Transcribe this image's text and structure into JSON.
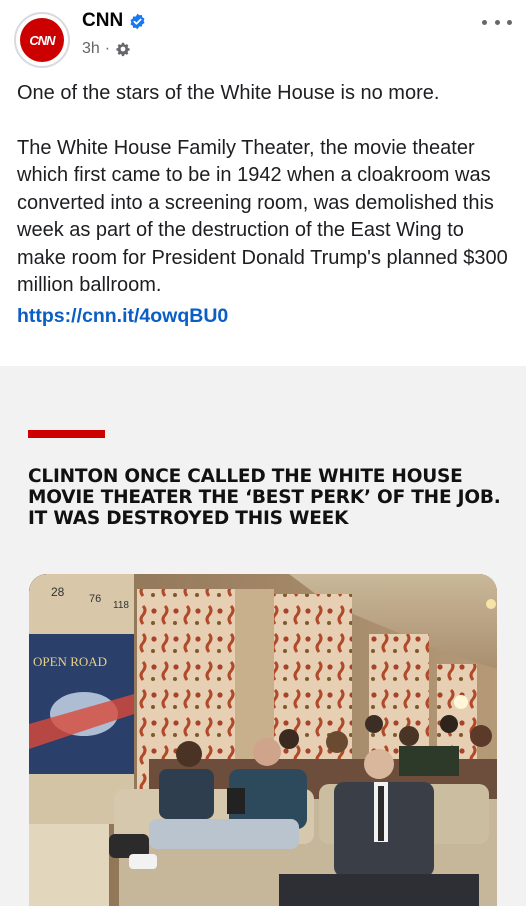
{
  "header": {
    "page_name": "CNN",
    "avatar_text": "CNN",
    "timestamp": "3h",
    "separator": "·"
  },
  "post": {
    "line1": "One of the stars of the White House is no more.",
    "body": "The White House Family Theater, the movie theater which first came to be in 1942 when a cloakroom was converted into a screening room, was demolished this week as part of the destruction of the East Wing to make room for President Donald Trump's planned $300 million ballroom.",
    "link": "https://cnn.it/4owqBU0"
  },
  "card": {
    "headline": "CLINTON ONCE CALLED THE WHITE HOUSE MOVIE THEATER THE ‘BEST PERK’ OF THE JOB. IT WAS DESTROYED THIS WEEK",
    "poster_text": "OPEN ROAD",
    "poster_numbers": [
      "28",
      "76",
      "118"
    ]
  },
  "colors": {
    "brand_red": "#cc0000",
    "link_blue": "#0a5ec4",
    "verified_blue": "#1877f2"
  }
}
